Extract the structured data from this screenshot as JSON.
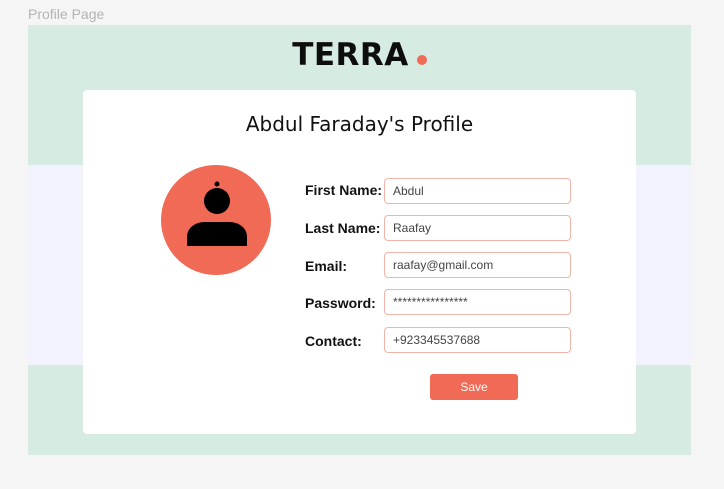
{
  "frame": {
    "label": "Profile Page"
  },
  "brand": {
    "name": "TERRA",
    "accent_color": "#f06a55"
  },
  "profile": {
    "title": "Abdul Faraday's Profile",
    "avatar_icon": "user-avatar-icon",
    "fields": [
      {
        "label": "First Name:",
        "value": "Abdul"
      },
      {
        "label": "Last Name:",
        "value": "Raafay"
      },
      {
        "label": "Email:",
        "value": "raafay@gmail.com"
      },
      {
        "label": "Password:",
        "value": "****************"
      },
      {
        "label": "Contact:",
        "value": "+923345537688"
      }
    ],
    "save_label": "Save"
  },
  "colors": {
    "frame_background": "#d6ebe1",
    "band_background": "#f3f3fd",
    "input_border": "#f2b3a8"
  }
}
